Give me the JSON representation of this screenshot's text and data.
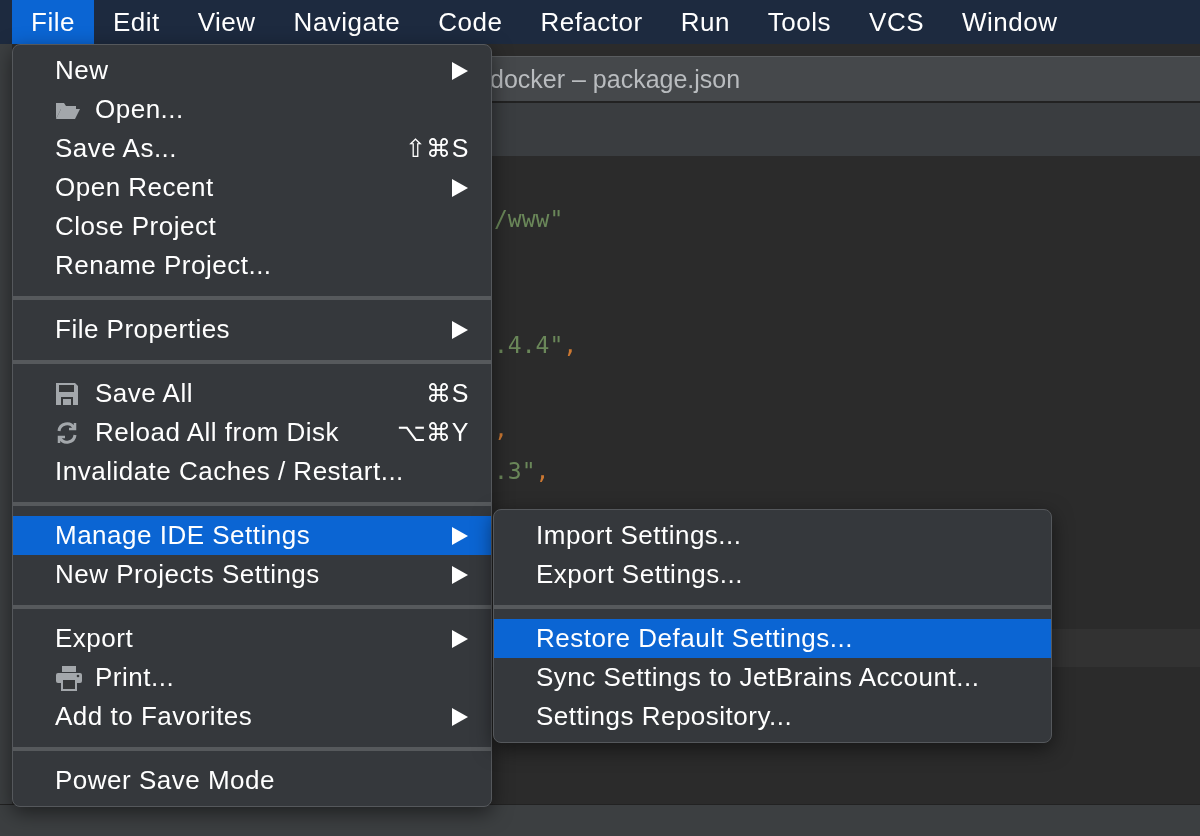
{
  "menu_bar": [
    {
      "label": "File",
      "selected": true
    },
    {
      "label": "Edit",
      "selected": false
    },
    {
      "label": "View",
      "selected": false
    },
    {
      "label": "Navigate",
      "selected": false
    },
    {
      "label": "Code",
      "selected": false
    },
    {
      "label": "Refactor",
      "selected": false
    },
    {
      "label": "Run",
      "selected": false
    },
    {
      "label": "Tools",
      "selected": false
    },
    {
      "label": "VCS",
      "selected": false
    },
    {
      "label": "Window",
      "selected": false
    }
  ],
  "window": {
    "title": "docker – package.json"
  },
  "editor": {
    "lines": [
      {
        "parts": [
          {
            "text": "/www\"",
            "kind": "string"
          }
        ]
      },
      {
        "parts": [
          {
            "text": ".4.4\"",
            "kind": "string"
          },
          {
            "text": ",",
            "kind": "punct"
          }
        ]
      },
      {
        "parts": [
          {
            "text": ",",
            "kind": "punct"
          }
        ]
      },
      {
        "parts": [
          {
            "text": ".3\"",
            "kind": "string"
          },
          {
            "text": ",",
            "kind": "punct"
          }
        ]
      }
    ]
  },
  "file_menu": {
    "groups": [
      [
        {
          "label": "New",
          "submenu": true,
          "selected": false
        },
        {
          "label": "Open...",
          "kind": "folder",
          "submenu": false,
          "selected": false
        },
        {
          "label": "Save As...",
          "shortcut": "⇧⌘S",
          "submenu": false,
          "selected": false
        },
        {
          "label": "Open Recent",
          "submenu": true,
          "selected": false
        },
        {
          "label": "Close Project",
          "submenu": false,
          "selected": false
        },
        {
          "label": "Rename Project...",
          "submenu": false,
          "selected": false
        }
      ],
      [
        {
          "label": "File Properties",
          "submenu": true,
          "selected": false
        }
      ],
      [
        {
          "label": "Save All",
          "kind": "floppy",
          "shortcut": "⌘S",
          "submenu": false,
          "selected": false
        },
        {
          "label": "Reload All from Disk",
          "kind": "reload",
          "shortcut": "⌥⌘Y",
          "submenu": false,
          "selected": false
        },
        {
          "label": "Invalidate Caches / Restart...",
          "submenu": false,
          "selected": false
        }
      ],
      [
        {
          "label": "Manage IDE Settings",
          "submenu": true,
          "selected": true
        },
        {
          "label": "New Projects Settings",
          "submenu": true,
          "selected": false
        }
      ],
      [
        {
          "label": "Export",
          "submenu": true,
          "selected": false
        },
        {
          "label": "Print...",
          "kind": "printer",
          "submenu": false,
          "selected": false
        },
        {
          "label": "Add to Favorites",
          "submenu": true,
          "selected": false
        }
      ],
      [
        {
          "label": "Power Save Mode",
          "submenu": false,
          "selected": false
        }
      ]
    ]
  },
  "settings_submenu": {
    "groups": [
      [
        {
          "label": "Import Settings...",
          "submenu": false,
          "selected": false
        },
        {
          "label": "Export Settings...",
          "submenu": false,
          "selected": false
        }
      ],
      [
        {
          "label": "Restore Default Settings...",
          "submenu": false,
          "selected": true
        },
        {
          "label": "Sync Settings to JetBrains Account...",
          "submenu": false,
          "selected": false
        },
        {
          "label": "Settings Repository...",
          "submenu": false,
          "selected": false
        }
      ]
    ]
  }
}
